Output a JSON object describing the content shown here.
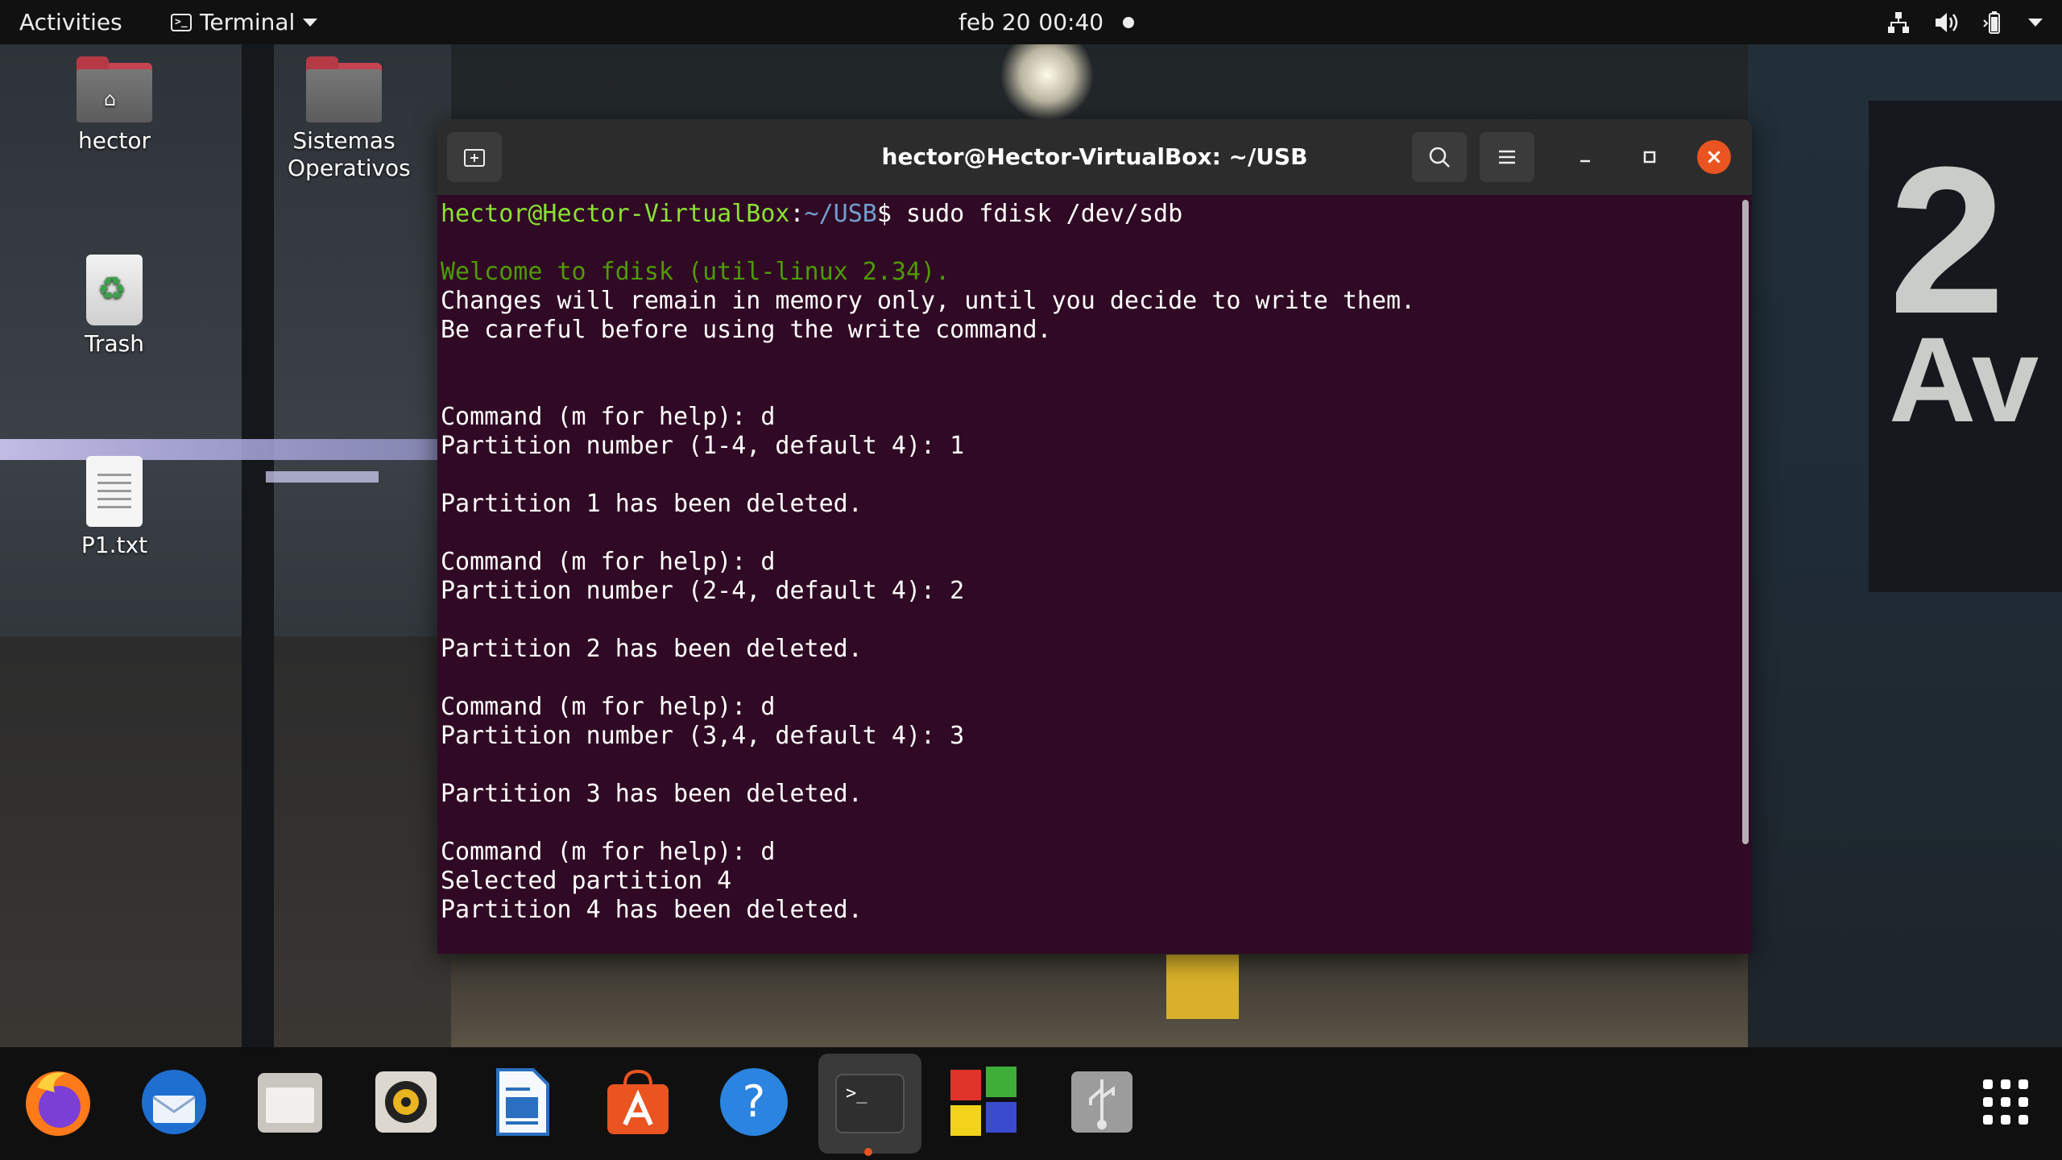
{
  "topbar": {
    "activities": "Activities",
    "app_name": "Terminal",
    "date": "feb 20",
    "time": "00:40",
    "icons": [
      "network-icon",
      "volume-icon",
      "battery-icon",
      "system-menu-arrow-icon"
    ]
  },
  "desktop": {
    "icons": [
      {
        "label": "hector",
        "icon": "home-folder-icon"
      },
      {
        "label": "Sistemas Operativos",
        "icon": "folder-icon"
      },
      {
        "label": "Trash",
        "icon": "trash-icon"
      },
      {
        "label": "P1.txt",
        "icon": "text-file-icon"
      }
    ]
  },
  "terminal": {
    "title": "hector@Hector-VirtualBox: ~/USB",
    "prompt_user": "hector@Hector-VirtualBox",
    "prompt_sep": ":",
    "prompt_path": "~/USB",
    "prompt_end": "$ ",
    "command": "sudo fdisk /dev/sdb",
    "lines": {
      "welcome": "Welcome to fdisk (util-linux 2.34).",
      "l2": "Changes will remain in memory only, until you decide to write them.",
      "l3": "Be careful before using the write command.",
      "c1": "Command (m for help): d",
      "p1": "Partition number (1-4, default 4): 1",
      "d1": "Partition 1 has been deleted.",
      "c2": "Command (m for help): d",
      "p2": "Partition number (2-4, default 4): 2",
      "d2": "Partition 2 has been deleted.",
      "c3": "Command (m for help): d",
      "p3": "Partition number (3,4, default 4): 3",
      "d3": "Partition 3 has been deleted.",
      "c4": "Command (m for help): d",
      "s4": "Selected partition 4",
      "d4": "Partition 4 has been deleted."
    },
    "colors": {
      "background": "#300a24",
      "prompt_user": "#8ae234",
      "prompt_path": "#729fcf",
      "welcome": "#4e9a06",
      "close_button": "#e95420"
    }
  },
  "dock": {
    "apps": [
      "firefox-icon",
      "thunderbird-icon",
      "files-icon",
      "rhythmbox-icon",
      "libreoffice-writer-icon",
      "ubuntu-software-icon",
      "help-icon",
      "terminal-icon",
      "windows-icon",
      "usb-icon"
    ],
    "show_apps": "show-applications-icon"
  }
}
